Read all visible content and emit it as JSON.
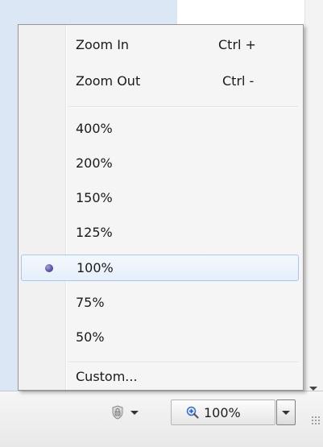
{
  "zoom_menu": {
    "commands": [
      {
        "label": "Zoom In",
        "shortcut": "Ctrl +"
      },
      {
        "label": "Zoom Out",
        "shortcut": "Ctrl -"
      }
    ],
    "levels": [
      {
        "label": "400%"
      },
      {
        "label": "200%"
      },
      {
        "label": "150%"
      },
      {
        "label": "125%"
      },
      {
        "label": "100%",
        "selected": true
      },
      {
        "label": "75%"
      },
      {
        "label": "50%"
      }
    ],
    "custom_label": "Custom..."
  },
  "status_bar": {
    "security_icon": "shield-lock-icon",
    "zoom_icon": "magnifier-plus-icon",
    "zoom_level": "100%"
  },
  "colors": {
    "selection_border": "#a8c7ee",
    "radio_dot": "#5c55a8",
    "page_left_strip": "#dce7f5"
  }
}
